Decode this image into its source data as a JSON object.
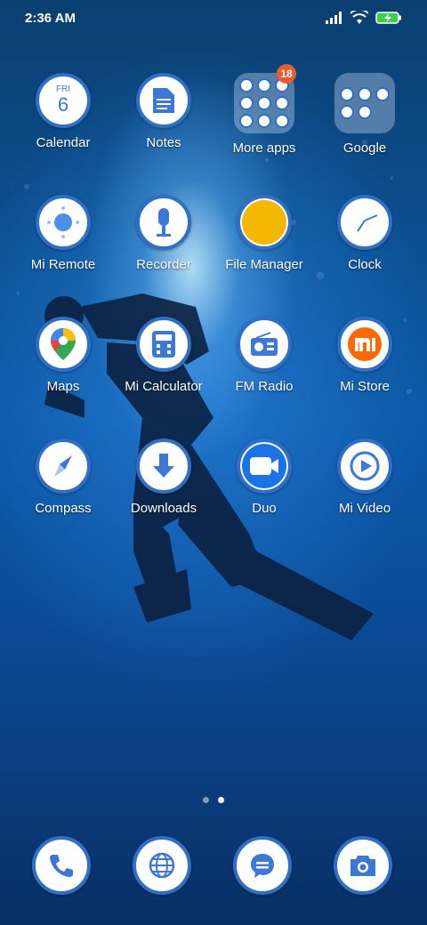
{
  "status_bar": {
    "time": "2:36 AM",
    "icons": [
      "signal-icon",
      "wifi-icon",
      "battery-charging-icon"
    ]
  },
  "home": {
    "rows": [
      [
        {
          "name": "calendar",
          "label": "Calendar",
          "icon": "calendar-icon",
          "day": "FRI",
          "date": "6"
        },
        {
          "name": "notes",
          "label": "Notes",
          "icon": "notes-icon"
        },
        {
          "name": "more-apps",
          "label": "More apps",
          "icon": "folder-icon",
          "badge": "18"
        },
        {
          "name": "google",
          "label": "Google",
          "icon": "folder-icon"
        }
      ],
      [
        {
          "name": "mi-remote",
          "label": "Mi Remote",
          "icon": "remote-icon"
        },
        {
          "name": "recorder",
          "label": "Recorder",
          "icon": "microphone-icon"
        },
        {
          "name": "file-manager",
          "label": "File Manager",
          "icon": "folder-circle-icon"
        },
        {
          "name": "clock",
          "label": "Clock",
          "icon": "clock-icon"
        }
      ],
      [
        {
          "name": "maps",
          "label": "Maps",
          "icon": "map-pin-icon"
        },
        {
          "name": "mi-calculator",
          "label": "Mi Calculator",
          "icon": "calculator-icon"
        },
        {
          "name": "fm-radio",
          "label": "FM Radio",
          "icon": "radio-icon"
        },
        {
          "name": "mi-store",
          "label": "Mi Store",
          "icon": "mi-logo-icon"
        }
      ],
      [
        {
          "name": "compass",
          "label": "Compass",
          "icon": "compass-icon"
        },
        {
          "name": "downloads",
          "label": "Downloads",
          "icon": "download-icon"
        },
        {
          "name": "duo",
          "label": "Duo",
          "icon": "video-camera-icon"
        },
        {
          "name": "mi-video",
          "label": "Mi Video",
          "icon": "play-icon"
        }
      ]
    ],
    "page_indicator": {
      "count": 2,
      "active": 2
    }
  },
  "dock": [
    {
      "name": "phone",
      "icon": "phone-icon"
    },
    {
      "name": "browser",
      "icon": "globe-icon"
    },
    {
      "name": "messages",
      "icon": "message-icon"
    },
    {
      "name": "camera",
      "icon": "camera-icon"
    }
  ],
  "colors": {
    "icon_ring": "#2f6fc7",
    "icon_accent": "#3b78d8",
    "badge": "#f05a28"
  }
}
